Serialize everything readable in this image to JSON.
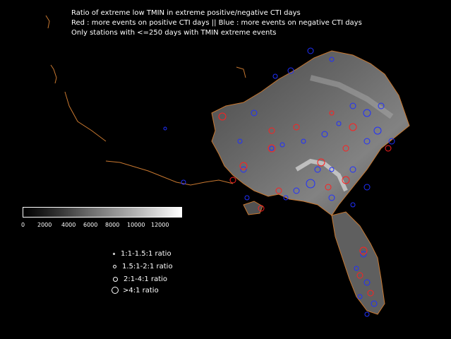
{
  "title": {
    "line1": "Ratio of extreme low TMIN in extreme positive/negative CTI days",
    "line2": "Red : more events on positive CTI days || Blue : more events on negative CTI days",
    "line3": "Only stations with <=250 days with TMIN extreme events"
  },
  "colorbar": {
    "ticks": [
      "0",
      "2000",
      "4000",
      "6000",
      "8000",
      "10000",
      "12000"
    ],
    "colors": [
      "#000000",
      "#ffffff"
    ]
  },
  "legend": [
    {
      "label": "1:1-1.5:1 ratio",
      "symbol": "tiny-circle"
    },
    {
      "label": "1.5:1-2:1 ratio",
      "symbol": "small-circle"
    },
    {
      "label": "2:1-4:1 ratio",
      "symbol": "medium-circle"
    },
    {
      "label": ">4:1 ratio",
      "symbol": "large-circle"
    }
  ],
  "colors": {
    "positive": "#ff2020",
    "negative": "#2030ff",
    "coastline": "#c87830",
    "background": "#000000"
  }
}
